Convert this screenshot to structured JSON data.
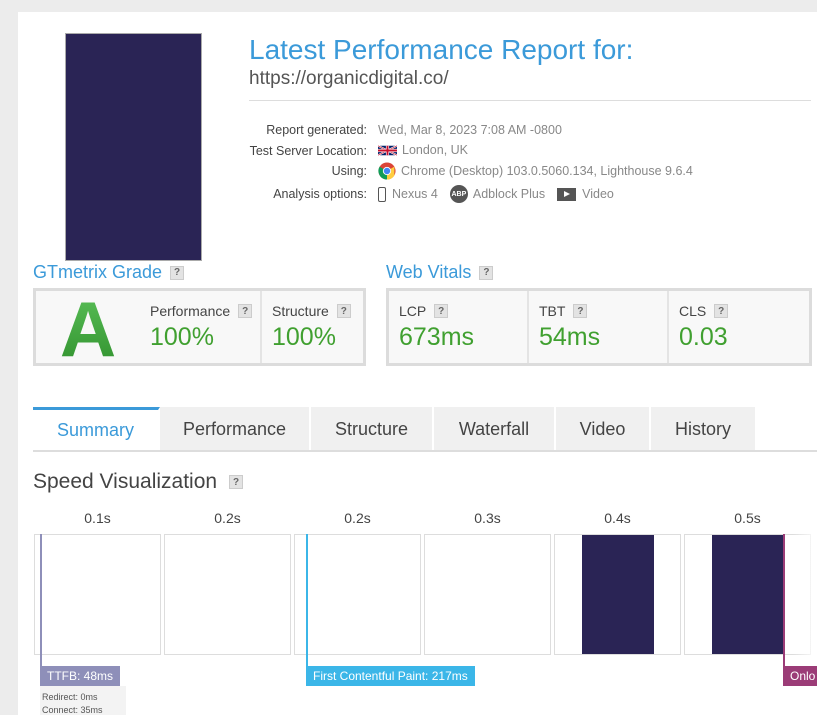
{
  "report": {
    "title": "Latest Performance Report for:",
    "url": "https://organicdigital.co/"
  },
  "meta": {
    "generated_label": "Report generated:",
    "generated_value": "Wed, Mar 8, 2023 7:08 AM -0800",
    "location_label": "Test Server Location:",
    "location_value": "London, UK",
    "using_label": "Using:",
    "using_value": "Chrome (Desktop) 103.0.5060.134, Lighthouse 9.6.4",
    "options_label": "Analysis options:",
    "options": [
      "Nexus 4",
      "Adblock Plus",
      "Video"
    ],
    "abp_text": "ABP"
  },
  "grade": {
    "heading": "GTmetrix Grade",
    "letter": "A",
    "performance_label": "Performance",
    "performance_value": "100%",
    "structure_label": "Structure",
    "structure_value": "100%"
  },
  "vitals": {
    "heading": "Web Vitals",
    "items": [
      {
        "label": "LCP",
        "value": "673ms"
      },
      {
        "label": "TBT",
        "value": "54ms"
      },
      {
        "label": "CLS",
        "value": "0.03"
      }
    ]
  },
  "help_glyph": "?",
  "tabs": [
    "Summary",
    "Performance",
    "Structure",
    "Waterfall",
    "Video",
    "History"
  ],
  "speed": {
    "title": "Speed Visualization",
    "frame_labels": [
      "0.1s",
      "0.2s",
      "0.2s",
      "0.3s",
      "0.4s",
      "0.5s"
    ],
    "markers": {
      "ttfb": "TTFB: 48ms",
      "fcp": "First Contentful Paint: 217ms",
      "onload": "Onlo"
    },
    "ttfb_details": [
      "Redirect: 0ms",
      "Connect: 35ms"
    ]
  },
  "colors": {
    "accent": "#3b9ad9",
    "grade_green": "#3fa63b",
    "thumb_fill": "#2a2455",
    "ttfb_marker": "#8e8fb9",
    "fcp_marker": "#3bb6e8",
    "onload_marker": "#9b3c77"
  }
}
